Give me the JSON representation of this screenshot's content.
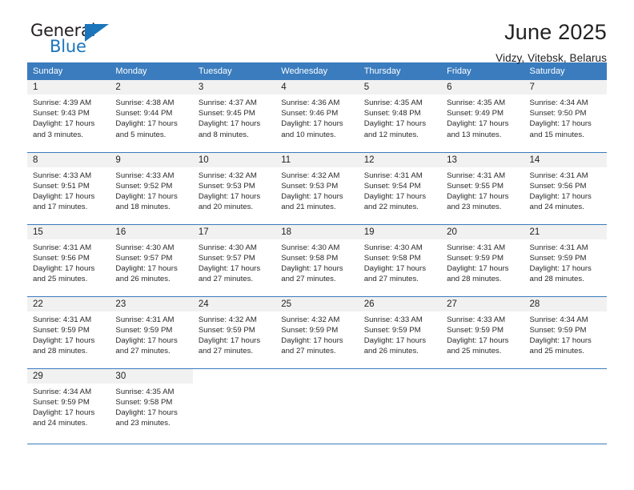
{
  "logo": {
    "word1": "General",
    "word2": "Blue",
    "triangle_color": "#1b75bb",
    "icon": "triangle-icon"
  },
  "header": {
    "title": "June 2025",
    "subtitle": "Vidzy, Vitebsk, Belarus"
  },
  "theme": {
    "header_blue": "#3a7cbe",
    "daynum_band": "#f1f1f1",
    "text": "#222222"
  },
  "calendar": {
    "weekday_headers": [
      "Sunday",
      "Monday",
      "Tuesday",
      "Wednesday",
      "Thursday",
      "Friday",
      "Saturday"
    ],
    "weeks": [
      [
        {
          "day": "1",
          "sunrise": "Sunrise: 4:39 AM",
          "sunset": "Sunset: 9:43 PM",
          "daylight1": "Daylight: 17 hours",
          "daylight2": "and 3 minutes."
        },
        {
          "day": "2",
          "sunrise": "Sunrise: 4:38 AM",
          "sunset": "Sunset: 9:44 PM",
          "daylight1": "Daylight: 17 hours",
          "daylight2": "and 5 minutes."
        },
        {
          "day": "3",
          "sunrise": "Sunrise: 4:37 AM",
          "sunset": "Sunset: 9:45 PM",
          "daylight1": "Daylight: 17 hours",
          "daylight2": "and 8 minutes."
        },
        {
          "day": "4",
          "sunrise": "Sunrise: 4:36 AM",
          "sunset": "Sunset: 9:46 PM",
          "daylight1": "Daylight: 17 hours",
          "daylight2": "and 10 minutes."
        },
        {
          "day": "5",
          "sunrise": "Sunrise: 4:35 AM",
          "sunset": "Sunset: 9:48 PM",
          "daylight1": "Daylight: 17 hours",
          "daylight2": "and 12 minutes."
        },
        {
          "day": "6",
          "sunrise": "Sunrise: 4:35 AM",
          "sunset": "Sunset: 9:49 PM",
          "daylight1": "Daylight: 17 hours",
          "daylight2": "and 13 minutes."
        },
        {
          "day": "7",
          "sunrise": "Sunrise: 4:34 AM",
          "sunset": "Sunset: 9:50 PM",
          "daylight1": "Daylight: 17 hours",
          "daylight2": "and 15 minutes."
        }
      ],
      [
        {
          "day": "8",
          "sunrise": "Sunrise: 4:33 AM",
          "sunset": "Sunset: 9:51 PM",
          "daylight1": "Daylight: 17 hours",
          "daylight2": "and 17 minutes."
        },
        {
          "day": "9",
          "sunrise": "Sunrise: 4:33 AM",
          "sunset": "Sunset: 9:52 PM",
          "daylight1": "Daylight: 17 hours",
          "daylight2": "and 18 minutes."
        },
        {
          "day": "10",
          "sunrise": "Sunrise: 4:32 AM",
          "sunset": "Sunset: 9:53 PM",
          "daylight1": "Daylight: 17 hours",
          "daylight2": "and 20 minutes."
        },
        {
          "day": "11",
          "sunrise": "Sunrise: 4:32 AM",
          "sunset": "Sunset: 9:53 PM",
          "daylight1": "Daylight: 17 hours",
          "daylight2": "and 21 minutes."
        },
        {
          "day": "12",
          "sunrise": "Sunrise: 4:31 AM",
          "sunset": "Sunset: 9:54 PM",
          "daylight1": "Daylight: 17 hours",
          "daylight2": "and 22 minutes."
        },
        {
          "day": "13",
          "sunrise": "Sunrise: 4:31 AM",
          "sunset": "Sunset: 9:55 PM",
          "daylight1": "Daylight: 17 hours",
          "daylight2": "and 23 minutes."
        },
        {
          "day": "14",
          "sunrise": "Sunrise: 4:31 AM",
          "sunset": "Sunset: 9:56 PM",
          "daylight1": "Daylight: 17 hours",
          "daylight2": "and 24 minutes."
        }
      ],
      [
        {
          "day": "15",
          "sunrise": "Sunrise: 4:31 AM",
          "sunset": "Sunset: 9:56 PM",
          "daylight1": "Daylight: 17 hours",
          "daylight2": "and 25 minutes."
        },
        {
          "day": "16",
          "sunrise": "Sunrise: 4:30 AM",
          "sunset": "Sunset: 9:57 PM",
          "daylight1": "Daylight: 17 hours",
          "daylight2": "and 26 minutes."
        },
        {
          "day": "17",
          "sunrise": "Sunrise: 4:30 AM",
          "sunset": "Sunset: 9:57 PM",
          "daylight1": "Daylight: 17 hours",
          "daylight2": "and 27 minutes."
        },
        {
          "day": "18",
          "sunrise": "Sunrise: 4:30 AM",
          "sunset": "Sunset: 9:58 PM",
          "daylight1": "Daylight: 17 hours",
          "daylight2": "and 27 minutes."
        },
        {
          "day": "19",
          "sunrise": "Sunrise: 4:30 AM",
          "sunset": "Sunset: 9:58 PM",
          "daylight1": "Daylight: 17 hours",
          "daylight2": "and 27 minutes."
        },
        {
          "day": "20",
          "sunrise": "Sunrise: 4:31 AM",
          "sunset": "Sunset: 9:59 PM",
          "daylight1": "Daylight: 17 hours",
          "daylight2": "and 28 minutes."
        },
        {
          "day": "21",
          "sunrise": "Sunrise: 4:31 AM",
          "sunset": "Sunset: 9:59 PM",
          "daylight1": "Daylight: 17 hours",
          "daylight2": "and 28 minutes."
        }
      ],
      [
        {
          "day": "22",
          "sunrise": "Sunrise: 4:31 AM",
          "sunset": "Sunset: 9:59 PM",
          "daylight1": "Daylight: 17 hours",
          "daylight2": "and 28 minutes."
        },
        {
          "day": "23",
          "sunrise": "Sunrise: 4:31 AM",
          "sunset": "Sunset: 9:59 PM",
          "daylight1": "Daylight: 17 hours",
          "daylight2": "and 27 minutes."
        },
        {
          "day": "24",
          "sunrise": "Sunrise: 4:32 AM",
          "sunset": "Sunset: 9:59 PM",
          "daylight1": "Daylight: 17 hours",
          "daylight2": "and 27 minutes."
        },
        {
          "day": "25",
          "sunrise": "Sunrise: 4:32 AM",
          "sunset": "Sunset: 9:59 PM",
          "daylight1": "Daylight: 17 hours",
          "daylight2": "and 27 minutes."
        },
        {
          "day": "26",
          "sunrise": "Sunrise: 4:33 AM",
          "sunset": "Sunset: 9:59 PM",
          "daylight1": "Daylight: 17 hours",
          "daylight2": "and 26 minutes."
        },
        {
          "day": "27",
          "sunrise": "Sunrise: 4:33 AM",
          "sunset": "Sunset: 9:59 PM",
          "daylight1": "Daylight: 17 hours",
          "daylight2": "and 25 minutes."
        },
        {
          "day": "28",
          "sunrise": "Sunrise: 4:34 AM",
          "sunset": "Sunset: 9:59 PM",
          "daylight1": "Daylight: 17 hours",
          "daylight2": "and 25 minutes."
        }
      ],
      [
        {
          "day": "29",
          "sunrise": "Sunrise: 4:34 AM",
          "sunset": "Sunset: 9:59 PM",
          "daylight1": "Daylight: 17 hours",
          "daylight2": "and 24 minutes."
        },
        {
          "day": "30",
          "sunrise": "Sunrise: 4:35 AM",
          "sunset": "Sunset: 9:58 PM",
          "daylight1": "Daylight: 17 hours",
          "daylight2": "and 23 minutes."
        },
        {
          "day": "",
          "sunrise": "",
          "sunset": "",
          "daylight1": "",
          "daylight2": ""
        },
        {
          "day": "",
          "sunrise": "",
          "sunset": "",
          "daylight1": "",
          "daylight2": ""
        },
        {
          "day": "",
          "sunrise": "",
          "sunset": "",
          "daylight1": "",
          "daylight2": ""
        },
        {
          "day": "",
          "sunrise": "",
          "sunset": "",
          "daylight1": "",
          "daylight2": ""
        },
        {
          "day": "",
          "sunrise": "",
          "sunset": "",
          "daylight1": "",
          "daylight2": ""
        }
      ]
    ]
  }
}
